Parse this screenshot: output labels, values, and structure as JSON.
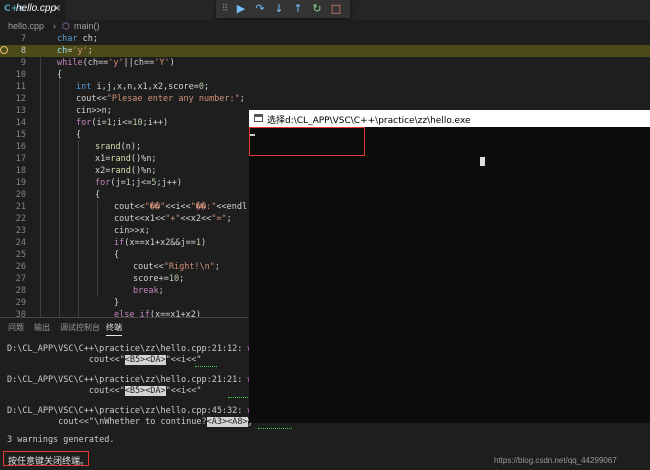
{
  "tab": {
    "icon": "C++",
    "label": "hello.cpp",
    "close": "×"
  },
  "debug_toolbar": {
    "grip": "⠿",
    "continue": "▶",
    "step_over": "↷",
    "step_into": "↓",
    "step_out": "↑",
    "restart": "↻",
    "stop": "□",
    "colors": {
      "continue": "#75beff",
      "restart": "#89d185",
      "stop": "#f48771"
    }
  },
  "breadcrumb": {
    "file": "hello.cpp",
    "sep": "›",
    "symbol_icon": "⬡",
    "symbol": "main()"
  },
  "editor": {
    "current_line": 8,
    "lines": [
      {
        "n": "7"
      },
      {
        "n": "8"
      },
      {
        "n": "9"
      },
      {
        "n": "10"
      },
      {
        "n": "11"
      },
      {
        "n": "12"
      },
      {
        "n": "13"
      },
      {
        "n": "14"
      },
      {
        "n": "15"
      },
      {
        "n": "16"
      },
      {
        "n": "17"
      },
      {
        "n": "18"
      },
      {
        "n": "19"
      },
      {
        "n": "20"
      },
      {
        "n": "21"
      },
      {
        "n": "22"
      },
      {
        "n": "23"
      },
      {
        "n": "24"
      },
      {
        "n": "25"
      },
      {
        "n": "26"
      },
      {
        "n": "27"
      },
      {
        "n": "28"
      },
      {
        "n": "29"
      },
      {
        "n": "30"
      }
    ],
    "code": {
      "l7a": "char",
      "l7b": " ch;",
      "l8a": "ch",
      "l8b": "=",
      "l8c": "'y'",
      "l8d": ";",
      "l9a": "while",
      "l9b": "(ch==",
      "l9c": "'y'",
      "l9d": "||ch==",
      "l9e": "'Y'",
      "l9f": ")",
      "l10": "{",
      "l11a": "int",
      "l11b": " i,j,x,n,x1,x2,score=",
      "l11c": "0",
      "l11d": ";",
      "l12a": "cout<<",
      "l12b": "\"Plesae enter any number:\"",
      "l12c": ";",
      "l13": "cin>>n;",
      "l14a": "for",
      "l14b": "(i=",
      "l14c": "1",
      "l14d": ";i<=",
      "l14e": "10",
      "l14f": ";i++)",
      "l15": "{",
      "l16a": "srand",
      "l16b": "(n);",
      "l17a": "x1=",
      "l17b": "rand",
      "l17c": "()%n;",
      "l18a": "x2=",
      "l18b": "rand",
      "l18c": "()%n;",
      "l19a": "for",
      "l19b": "(j=",
      "l19c": "1",
      "l19d": ";j<=",
      "l19e": "5",
      "l19f": ";j++)",
      "l20": "{",
      "l21a": "cout<<",
      "l21b": "\"��\"",
      "l21c": "<<i<<",
      "l21d": "\"��:\"",
      "l21e": "<<endl",
      "l22a": "cout<<x1<<",
      "l22b": "\"+\"",
      "l22c": "<<x2<<",
      "l22d": "\"=\"",
      "l22e": ";",
      "l23": "cin>>x;",
      "l24a": "if",
      "l24b": "(x==x1+x2&&j==",
      "l24c": "1",
      "l24d": ")",
      "l25": "{",
      "l26a": "cout<<",
      "l26b": "\"Right!\\n\"",
      "l26c": ";",
      "l27a": "score+=",
      "l27b": "10",
      "l27c": ";",
      "l28a": "break",
      "l28b": ";",
      "l29": "}",
      "l30a": "else if",
      "l30b": "(x==x1+x2)"
    }
  },
  "panel": {
    "tabs": [
      "问题",
      "输出",
      "调试控制台",
      "终端"
    ],
    "terminal": {
      "w1_path": "D:\\CL_APP\\VSC\\C++\\practice\\zz\\hello.cpp:21:12: ",
      "w1_warn": "warning",
      "w1_src_a": "                cout<<\"",
      "w1_hl1": "<B5>",
      "w1_hl2": "<DA>",
      "w1_src_b": "\"<<i<<\"",
      "w2_path": "D:\\CL_APP\\VSC\\C++\\practice\\zz\\hello.cpp:21:21: ",
      "w2_warn": "warning",
      "w2_src_a": "                cout<<\"",
      "w2_hl1": "<B5>",
      "w2_hl2": "<DA>",
      "w2_src_b": "\"<<i<<\"",
      "w3_path": "D:\\CL_APP\\VSC\\C++\\practice\\zz\\hello.cpp:45:32: ",
      "w3_warn": "warning",
      "w3_src_a": "          cout<<\"\\nWhether to continue?",
      "w3_hl1": "<A3>",
      "w3_hl2": "<A8>",
      "w3_src_b": "y",
      "summary": "3 warnings generated.",
      "prompt": "按任意键关闭终端。"
    }
  },
  "console": {
    "title": "选择d:\\CL_APP\\VSC\\C++\\practice\\zz\\hello.exe"
  },
  "watermark": "https://blog.csdn.net/qq_44299067"
}
